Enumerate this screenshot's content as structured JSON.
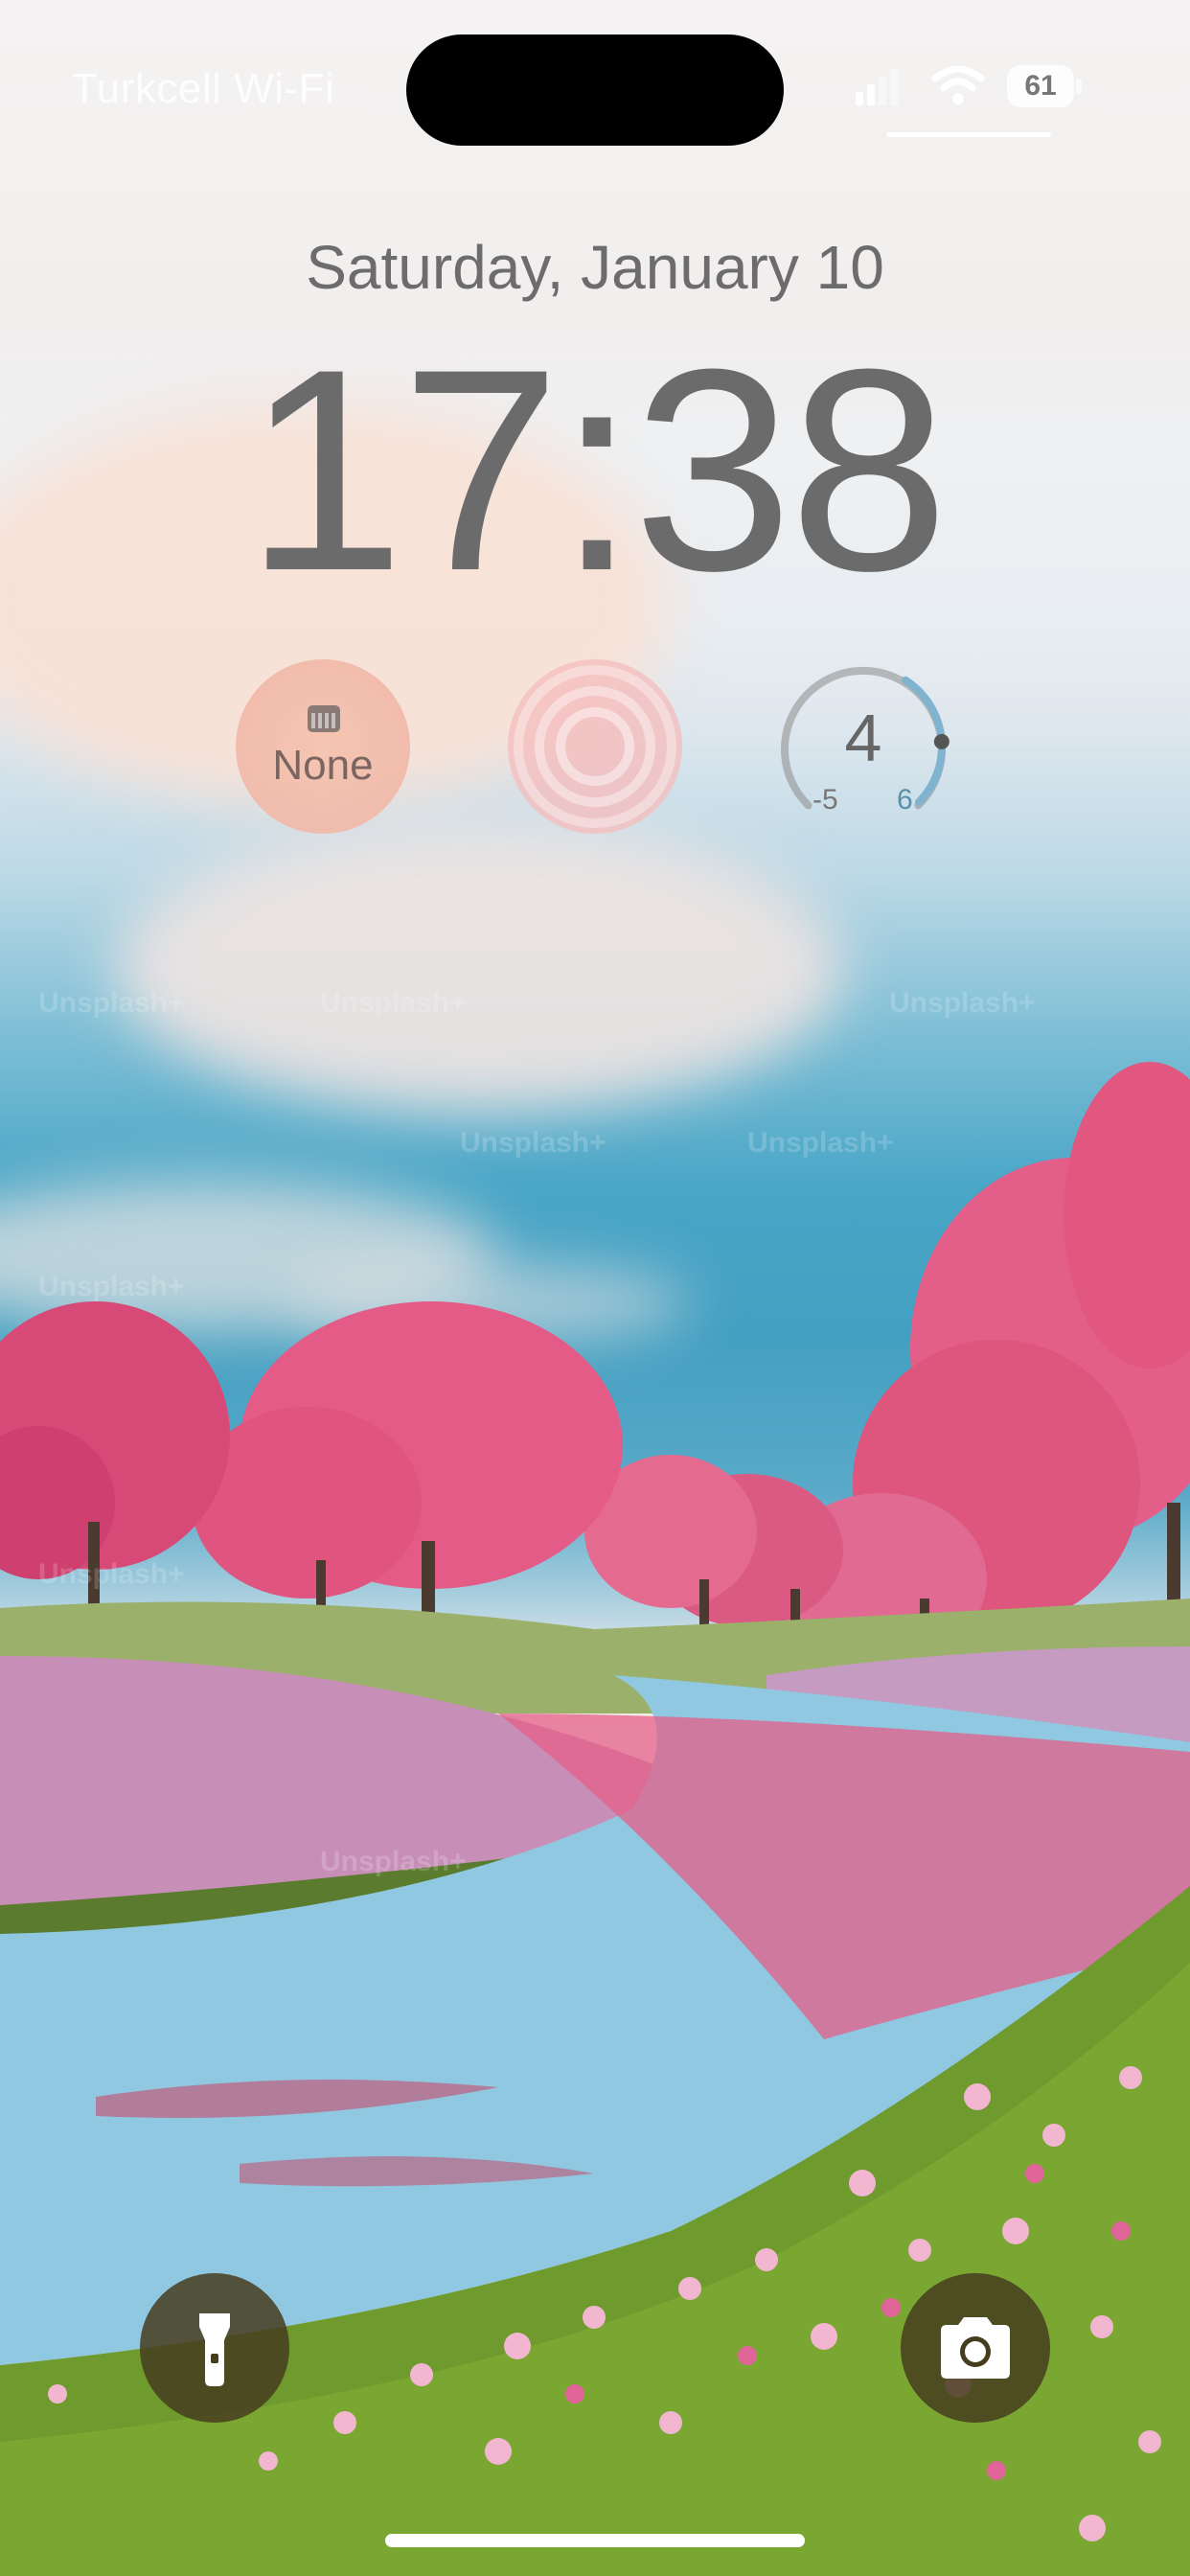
{
  "status_bar": {
    "carrier": "Turkcell Wi-Fi",
    "battery_percent": "61",
    "icons": [
      "cellular-signal-icon",
      "wifi-icon",
      "battery-icon"
    ]
  },
  "lock_screen": {
    "date": "Saturday, January 10",
    "time": "17:38"
  },
  "widgets": {
    "calendar": {
      "icon": "calendar-icon",
      "label": "None"
    },
    "rings": {
      "icon": "activity-rings-icon"
    },
    "temperature": {
      "value": "4",
      "min": "-5",
      "max": "6",
      "level": 0.82
    }
  },
  "wallpaper": {
    "watermark": "Unsplash+"
  },
  "quick_actions": {
    "left": {
      "icon": "flashlight-icon"
    },
    "right": {
      "icon": "camera-icon"
    }
  },
  "colors": {
    "sky_blue": "#44a0c2",
    "blossom_pink": "#e86a8f",
    "grass_green": "#5c8c2a",
    "widget_pink": "#f2c0b2",
    "button_dark": "#463c1e"
  }
}
